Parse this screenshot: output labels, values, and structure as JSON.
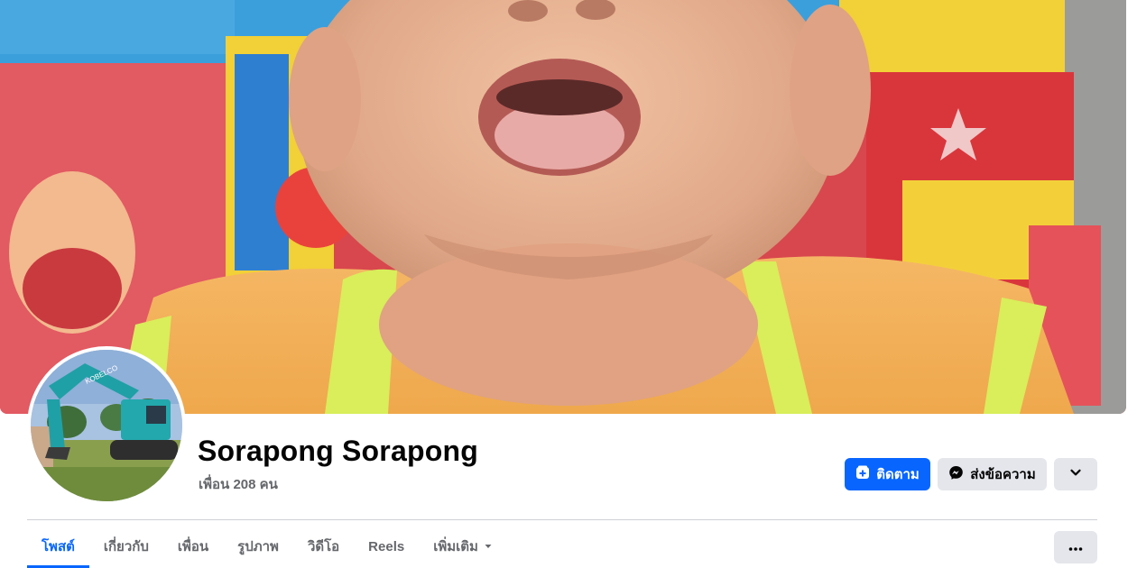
{
  "profile": {
    "name": "Sorapong Sorapong",
    "friends_count": "เพื่อน 208 คน"
  },
  "actions": {
    "follow_label": "ติดตาม",
    "message_label": "ส่งข้อความ"
  },
  "tabs": [
    {
      "label": "โพสต์",
      "active": true
    },
    {
      "label": "เกี่ยวกับ",
      "active": false
    },
    {
      "label": "เพื่อน",
      "active": false
    },
    {
      "label": "รูปภาพ",
      "active": false
    },
    {
      "label": "วิดีโอ",
      "active": false
    },
    {
      "label": "Reels",
      "active": false
    },
    {
      "label": "เพิ่มเติม",
      "active": false
    }
  ],
  "colors": {
    "accent": "#0866ff",
    "secondary_button": "#e4e6eb",
    "muted_text": "#65676b",
    "primary_text": "#050505"
  },
  "icons": {
    "follow": "user-plus-icon",
    "message": "messenger-icon",
    "more_actions": "chevron-down-icon",
    "tab_more": "caret-down-icon",
    "tab_overflow": "more-dots-icon"
  }
}
